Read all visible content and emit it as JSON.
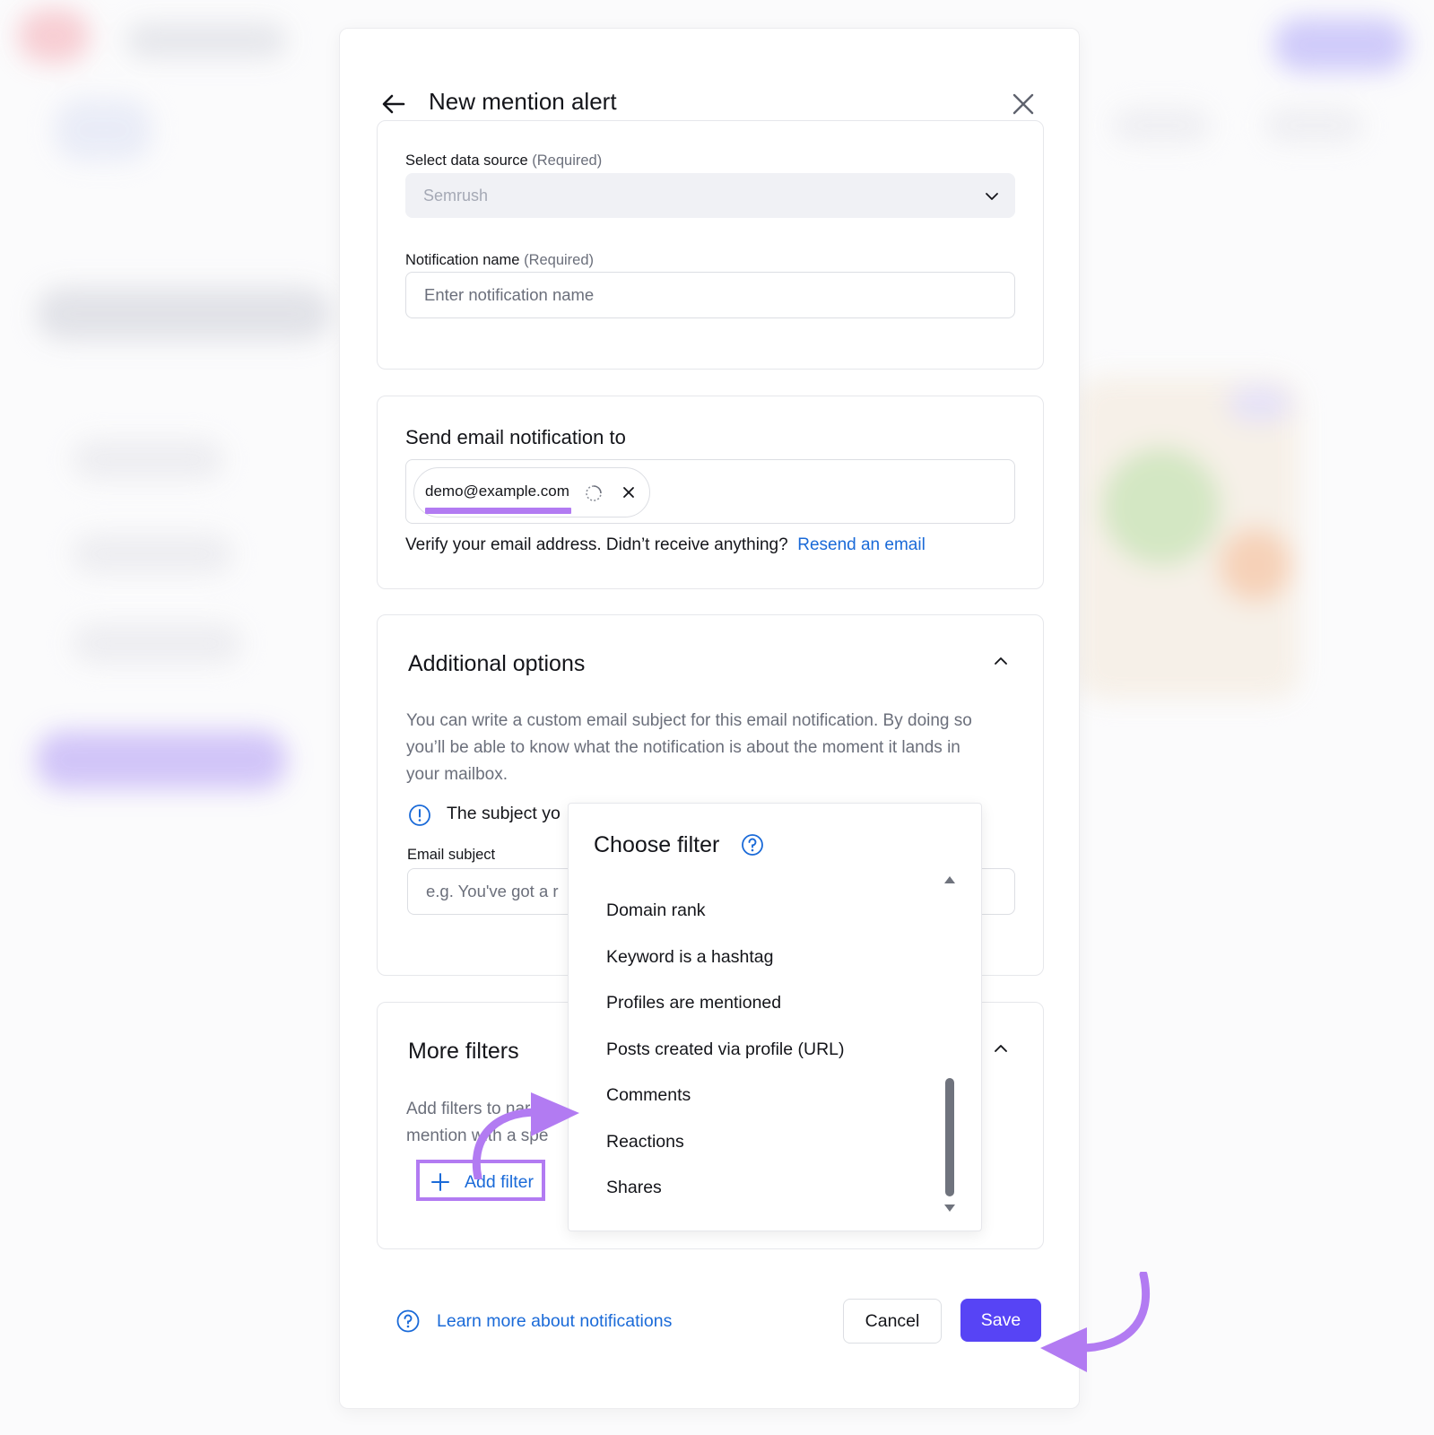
{
  "modal": {
    "title": "New mention alert"
  },
  "data_source": {
    "label": "Select data source",
    "required": "(Required)",
    "value": "Semrush"
  },
  "notification_name": {
    "label": "Notification name",
    "required": "(Required)",
    "placeholder": "Enter notification name"
  },
  "email_section": {
    "title": "Send email notification to",
    "chip_email": "demo@example.com",
    "verify_text": "Verify your email address. Didn’t receive anything?",
    "resend_link": "Resend an email"
  },
  "additional_options": {
    "title": "Additional options",
    "description": "You can write a custom email subject for this email notification. By doing so you’ll be able to know what the notification is about the moment it lands in your mailbox.",
    "warning_text": "The subject yo",
    "subject_label": "Email subject",
    "subject_placeholder": "e.g. You've got a r"
  },
  "more_filters": {
    "title": "More filters",
    "description_line1": "Add filters to narro",
    "description_line2": "mention with a spe",
    "add_filter_label": "Add filter"
  },
  "filter_dropdown": {
    "title": "Choose filter",
    "items": [
      "Domain rank",
      "Keyword is a hashtag",
      "Profiles are mentioned",
      "Posts created via profile (URL)",
      "Comments",
      "Reactions",
      "Shares"
    ]
  },
  "footer": {
    "learn_more": "Learn more about notifications",
    "cancel": "Cancel",
    "save": "Save"
  },
  "colors": {
    "accent_purple": "#b27bf2",
    "save_button": "#5744f5",
    "link_blue": "#1a6ad8"
  }
}
